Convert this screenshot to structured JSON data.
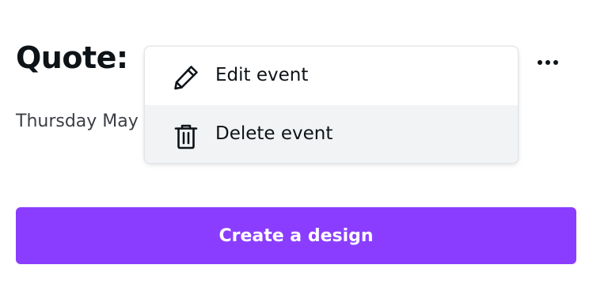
{
  "event": {
    "title": "Quote:",
    "date": "Thursday May"
  },
  "more_button": {
    "icon": "more-horizontal-icon"
  },
  "context_menu": {
    "items": [
      {
        "label": "Edit event",
        "icon": "pencil-icon"
      },
      {
        "label": "Delete event",
        "icon": "trash-icon"
      }
    ]
  },
  "primary_action": {
    "label": "Create a design"
  },
  "colors": {
    "accent": "#8b3dff",
    "text": "#0e1318",
    "hover_background": "#f2f3f5"
  }
}
